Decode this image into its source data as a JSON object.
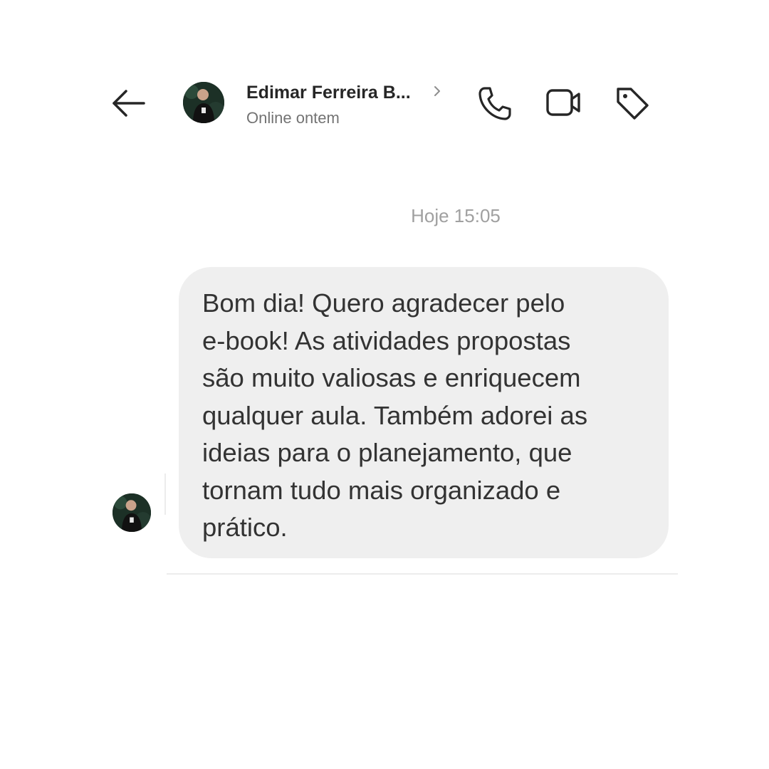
{
  "header": {
    "contact_name": "Edimar Ferreira B...",
    "status": "Online ontem",
    "icons": {
      "back": "arrow-left-icon",
      "profile": "chevron-right-icon",
      "call": "phone-icon",
      "video": "video-camera-icon",
      "tag": "tag-icon"
    }
  },
  "conversation": {
    "timestamp": "Hoje 15:05",
    "messages": [
      {
        "text": "Bom dia! Quero agradecer pelo\ne-book! As atividades propostas\nsão muito valiosas e enriquecem\nqualquer aula. Também adorei as\nideias para o planejamento, que\ntornam tudo mais organizado e\nprático."
      }
    ]
  },
  "colors": {
    "bubble_background": "#efefef",
    "text": "#333333",
    "status_text": "#737373",
    "timestamp_text": "#a0a0a0"
  }
}
